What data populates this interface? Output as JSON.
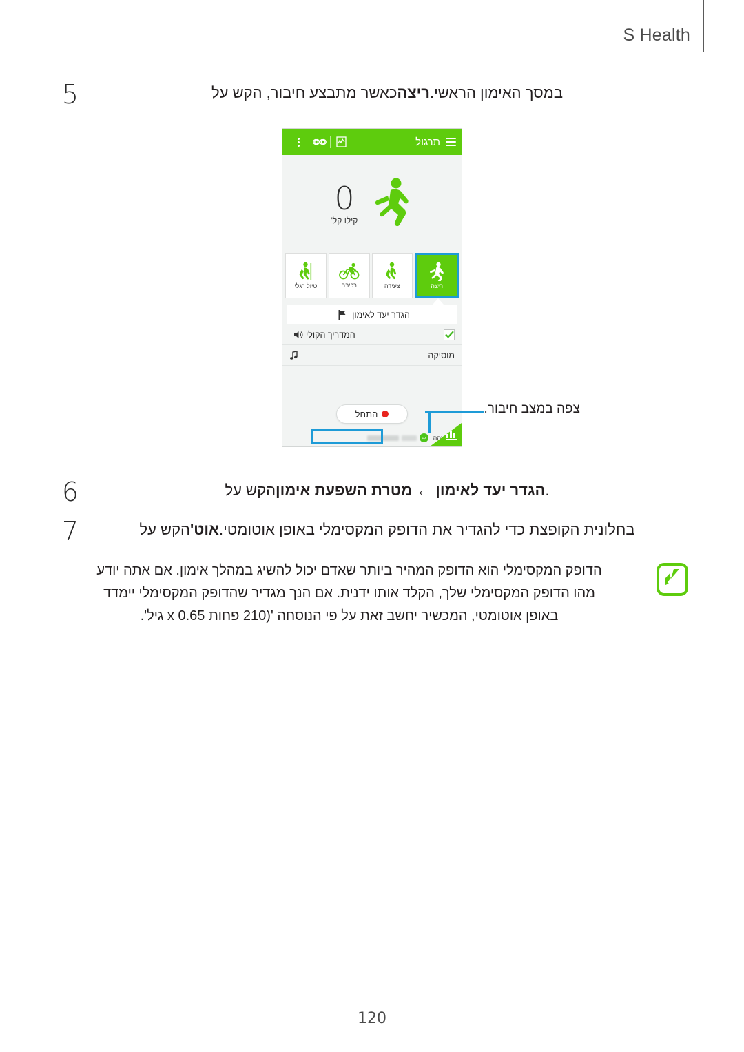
{
  "header": {
    "title": "S Health"
  },
  "steps": [
    {
      "number": "5",
      "prefix": "כאשר מתבצע חיבור, הקש על ",
      "bold": "ריצה",
      "suffix": " במסך האימון הראשי."
    },
    {
      "number": "6",
      "prefix": "הקש על ",
      "bold": "הגדר יעד לאימון ← מטרת השפעת אימון",
      "suffix": "."
    },
    {
      "number": "7",
      "prefix": "הקש על ",
      "bold": "אוט'",
      "suffix": " בחלונית הקופצת כדי להגדיר את הדופק המקסימלי באופן אוטומטי."
    }
  ],
  "callout": {
    "text": "צפה במצב חיבור."
  },
  "phone": {
    "topbar": {
      "title": "תרגול",
      "menu_icon": "hamburger-icon",
      "report_icon": "chart-report-icon",
      "link_icon": "link-icon",
      "overflow_icon": "overflow-menu-icon"
    },
    "hero": {
      "figure_icon": "running-figure-icon",
      "value": "0",
      "unit": "קילו קל'"
    },
    "tabs": [
      {
        "label": "ריצה",
        "icon": "running-icon",
        "active": true
      },
      {
        "label": "צעידה",
        "icon": "walking-icon",
        "active": false
      },
      {
        "label": "רכיבה",
        "icon": "cycling-icon",
        "active": false
      },
      {
        "label": "טיול רגלי",
        "icon": "hiking-icon",
        "active": false
      }
    ],
    "rows": [
      {
        "label": "הגדר יעד לאימון",
        "icon": "flag-icon",
        "type": "goal"
      },
      {
        "label": "המדריך הקולי",
        "icon": "speaker-icon",
        "type": "toggle",
        "checked": true
      },
      {
        "label": "מוסיקה",
        "icon": "music-note-icon",
        "type": "plain"
      }
    ],
    "start_button": {
      "label": "התחל",
      "icon": "record-dot-icon"
    },
    "status": {
      "id_label": "מזהה",
      "id_icon": "id-status-icon",
      "chip_icon": "connected-badge-icon",
      "chip_text": ""
    },
    "corner": {
      "icon": "bar-chart-icon"
    }
  },
  "note": {
    "icon": "note-pencil-icon",
    "lines": [
      "הדופק המקסימלי הוא הדופק המהיר ביותר שאדם יכול להשיג במהלך אימון. אם אתה יודע",
      "מהו הדופק המקסימלי שלך, הקלד אותו ידנית. אם הנך מגדיר שהדופק המקסימלי יימדד",
      "באופן אוטומטי, המכשיר יחשב זאת על פי הנוסחה '(210 פחות 0.65 x גיל'."
    ]
  },
  "footer": {
    "page_number": "120"
  },
  "colors": {
    "brand_green": "#5ecc0d",
    "highlight_blue": "#1e9bd7",
    "record_red": "#e8251f",
    "text": "#231f20"
  }
}
